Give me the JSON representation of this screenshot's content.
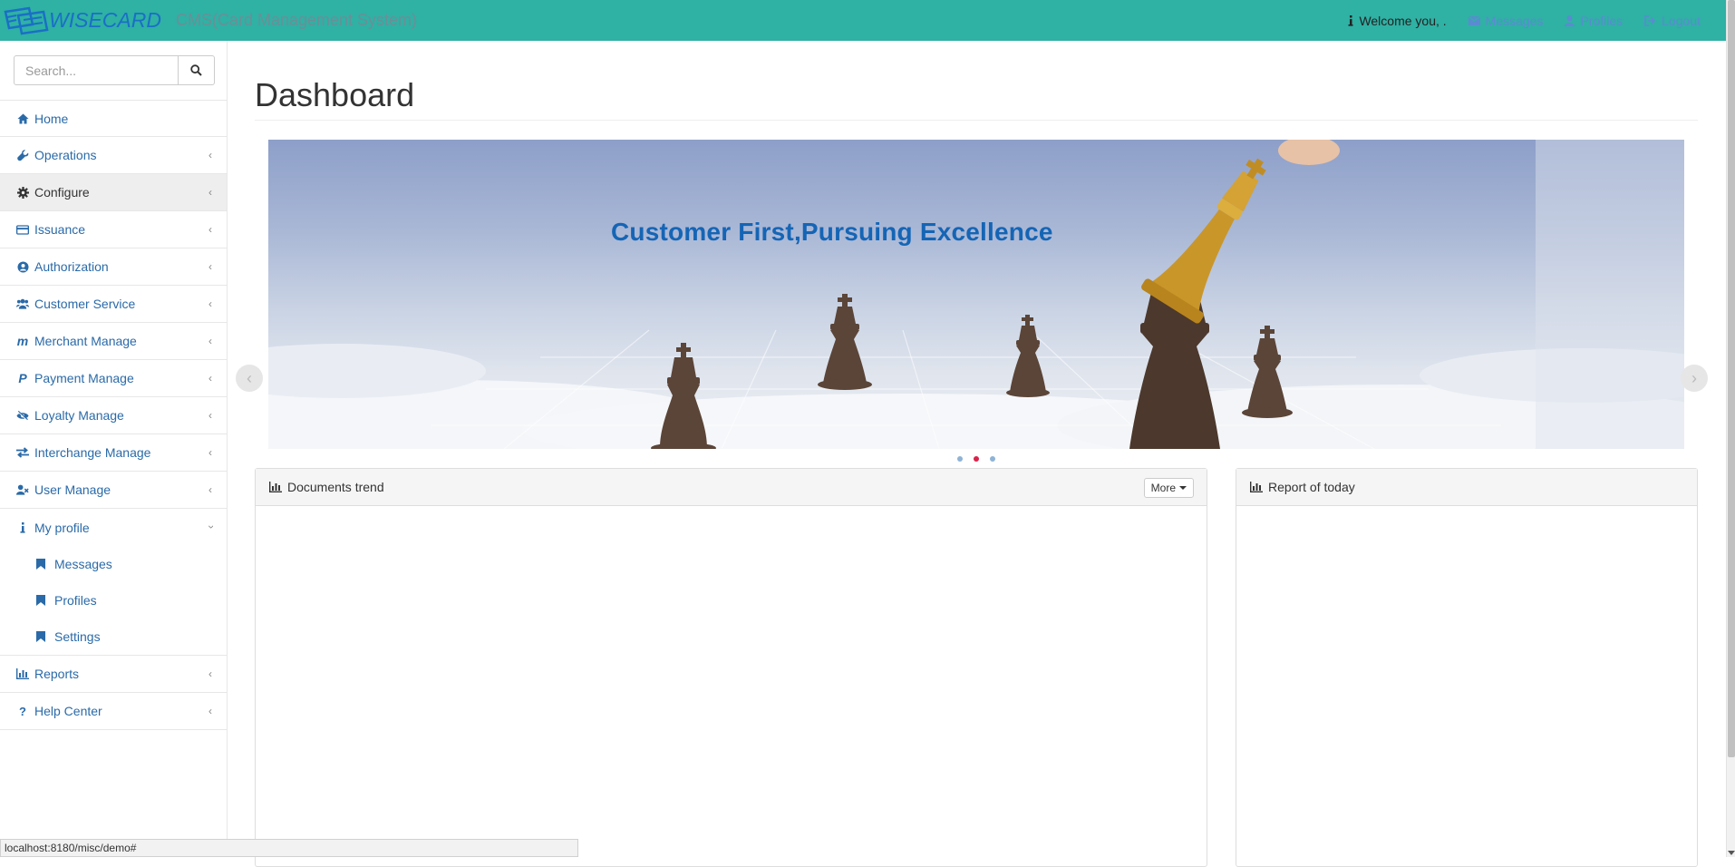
{
  "brand": {
    "name": "WISECARD",
    "subtitle": "CMS(Card Management System)"
  },
  "topnav": {
    "welcome": "Welcome you, .",
    "messages": "Messages",
    "profiles": "Profiles",
    "logout": "Logout"
  },
  "search": {
    "placeholder": "Search..."
  },
  "sidebar": {
    "items": [
      {
        "label": "Home",
        "icon": "home-icon"
      },
      {
        "label": "Operations",
        "icon": "wrench-icon"
      },
      {
        "label": "Configure",
        "icon": "gear-icon"
      },
      {
        "label": "Issuance",
        "icon": "credit-card-icon"
      },
      {
        "label": "Authorization",
        "icon": "user-circle-icon"
      },
      {
        "label": "Customer Service",
        "icon": "users-icon"
      },
      {
        "label": "Merchant Manage",
        "icon": "m-letter-icon"
      },
      {
        "label": "Payment Manage",
        "icon": "paypal-icon"
      },
      {
        "label": "Loyalty Manage",
        "icon": "eye-slash-icon"
      },
      {
        "label": "Interchange Manage",
        "icon": "exchange-icon"
      },
      {
        "label": "User Manage",
        "icon": "user-times-icon"
      },
      {
        "label": "My profile",
        "icon": "info-icon"
      },
      {
        "label": "Reports",
        "icon": "bar-chart-icon"
      },
      {
        "label": "Help Center",
        "icon": "question-icon"
      }
    ],
    "profile_sub": [
      {
        "label": "Messages",
        "icon": "bookmark-icon"
      },
      {
        "label": "Profiles",
        "icon": "bookmark-icon"
      },
      {
        "label": "Settings",
        "icon": "bookmark-icon"
      }
    ]
  },
  "main": {
    "title": "Dashboard",
    "carousel": {
      "slogan": "Customer First,Pursuing Excellence",
      "slides": 3,
      "active_slide": 2
    },
    "panels": {
      "documents_trend": "Documents trend",
      "more": "More",
      "report_today": "Report of today"
    }
  },
  "status_bar": {
    "url": "localhost:8180/misc/demo#"
  },
  "colors": {
    "navbar": "#2fb1a4",
    "link": "#2a6aa8",
    "brand": "#1a6fc6",
    "slogan": "#1565b5",
    "active_indicator": "#d9234a"
  }
}
